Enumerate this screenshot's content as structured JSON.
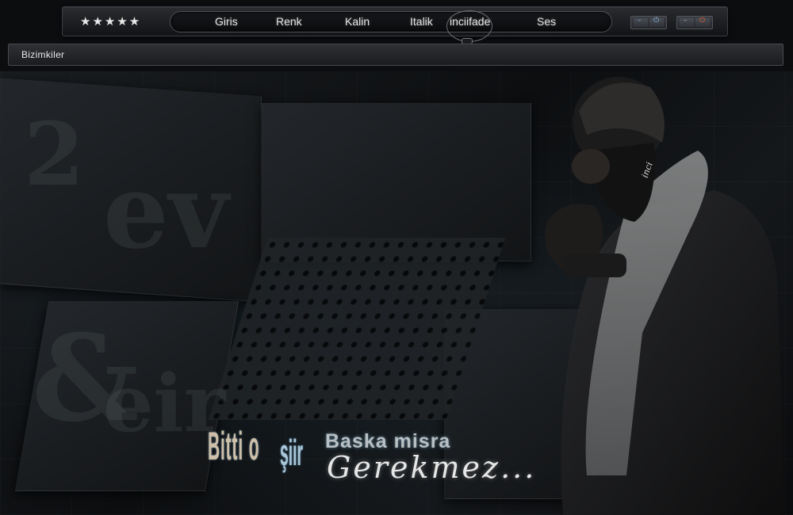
{
  "toolbar": {
    "stars": "★★★★★",
    "menu": [
      "Giris",
      "Renk",
      "Kalin",
      "Italik",
      "inciifade",
      "Ses"
    ]
  },
  "window_buttons": {
    "button1": {
      "left_icon": "minimize-icon",
      "right_icon": "power-icon"
    },
    "button2": {
      "left_icon": "minimize-icon",
      "right_icon": "power-icon"
    }
  },
  "header": {
    "title": "Bizimkiler"
  },
  "artwork": {
    "signature": "inci",
    "line1a": "Bitti o",
    "line1b": "şiir",
    "line2": "Baska misra",
    "line3": "Gerekmez..."
  },
  "colors": {
    "accent_blue": "#8fb8e6",
    "power_orange": "#e0622e",
    "background": "#0c0d0f"
  }
}
